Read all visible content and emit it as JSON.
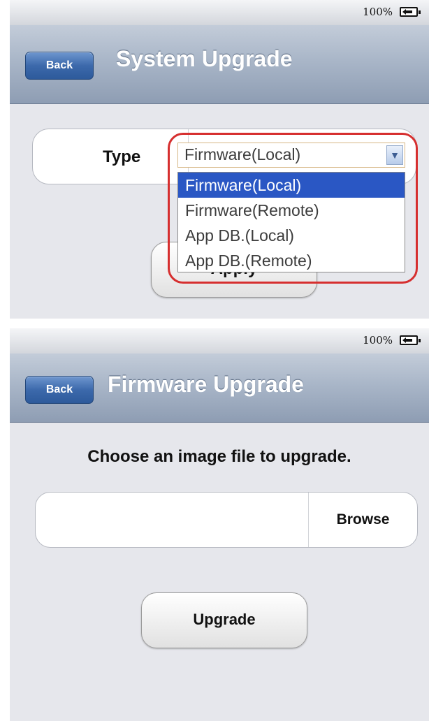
{
  "colors": {
    "screen_background": "#e6e7ec",
    "nav_bar": "#a9b6c8",
    "back_button": "#3c69ab",
    "selected_option": "#2a57c4",
    "highlight_ring": "#d62f2f"
  },
  "system_upgrade": {
    "status": {
      "battery_percent": "100%",
      "battery_icon": "battery-charging-icon"
    },
    "nav": {
      "back_label": "Back",
      "title": "System Upgrade"
    },
    "form": {
      "type_label": "Type",
      "type_value": "Firmware(Local)",
      "options": [
        "Firmware(Local)",
        "Firmware(Remote)",
        "App DB.(Local)",
        "App DB.(Remote)"
      ],
      "selected_option_index": 0,
      "apply_label": "Apply"
    }
  },
  "firmware_upgrade": {
    "status": {
      "battery_percent": "100%",
      "battery_icon": "battery-charging-icon"
    },
    "nav": {
      "back_label": "Back",
      "title": "Firmware Upgrade"
    },
    "form": {
      "prompt": "Choose an image file to upgrade.",
      "file_value": "",
      "browse_label": "Browse",
      "upgrade_label": "Upgrade"
    }
  }
}
